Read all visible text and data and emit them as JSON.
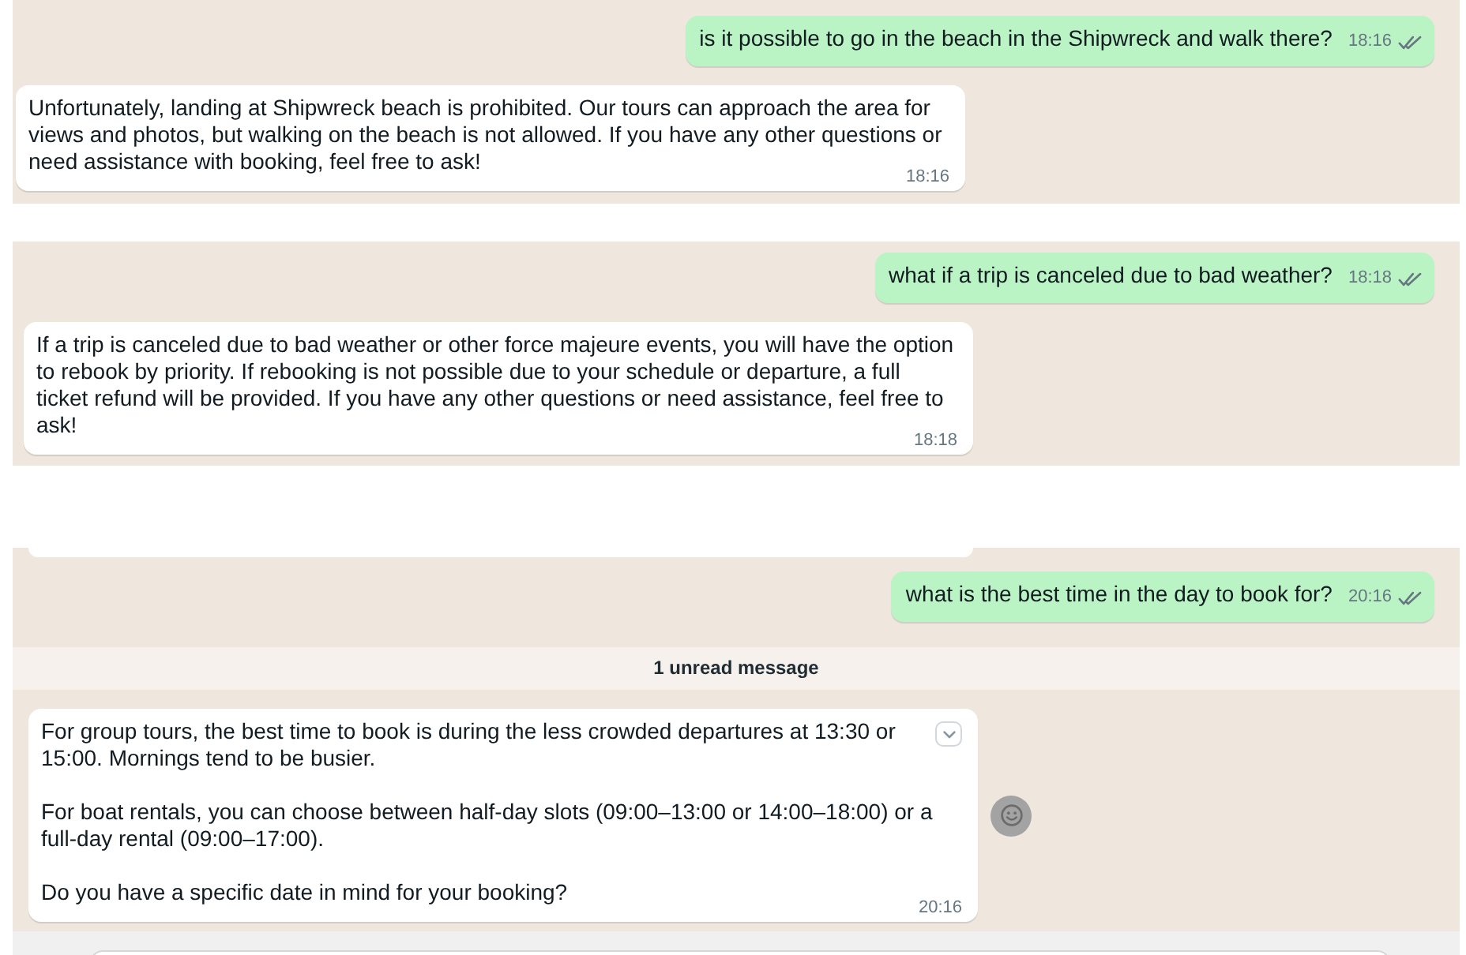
{
  "panels": [
    {
      "messages": [
        {
          "kind": "outgoing",
          "text": "is it possible to go in the beach in the Shipwreck and walk there?",
          "time": "18:16",
          "delivered": true,
          "read": false
        },
        {
          "kind": "incoming",
          "paragraphs": [
            "Unfortunately, landing at Shipwreck beach is prohibited. Our tours can approach the area for views and photos, but walking on the beach is not allowed. If you have any other questions or need assistance with booking, feel free to ask!"
          ],
          "time": "18:16",
          "menu_button": false,
          "reaction_button": false
        }
      ],
      "composer": false
    },
    {
      "messages": [
        {
          "kind": "outgoing",
          "text": "what if a trip is canceled due to bad weather?",
          "time": "18:18",
          "delivered": true,
          "read": false
        },
        {
          "kind": "incoming",
          "paragraphs": [
            "If a trip is canceled due to bad weather or other force majeure events, you will have the option to rebook by priority. If rebooking is not possible due to your schedule or departure, a full ticket refund will be provided. If you have any other questions or need assistance, feel free to ask!"
          ],
          "time": "18:18",
          "menu_button": false,
          "reaction_button": false
        }
      ],
      "composer": false
    },
    {
      "messages": [
        {
          "kind": "clipped"
        },
        {
          "kind": "outgoing",
          "text": "what is the best time in the day to book for?",
          "time": "20:16",
          "delivered": true,
          "read": false
        },
        {
          "kind": "unread_divider",
          "text": "1 unread message"
        },
        {
          "kind": "incoming",
          "paragraphs": [
            "For group tours, the best time to book is during the less crowded departures at 13:30 or 15:00. Mornings tend to be busier.",
            "For boat rentals, you can choose between half-day slots (09:00–13:00 or 14:00–18:00) or a full-day rental (09:00–17:00).",
            "Do you have a specific date in mind for your booking?"
          ],
          "time": "20:16",
          "menu_button": true,
          "reaction_button": true
        }
      ],
      "composer": true
    }
  ]
}
